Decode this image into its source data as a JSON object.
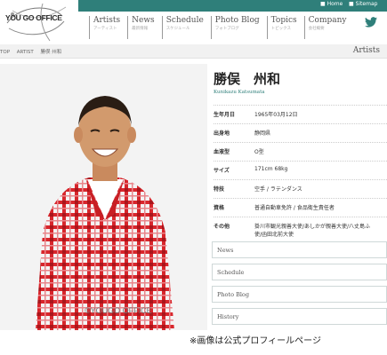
{
  "header": {
    "logo_text": "YOU GO OFFICE",
    "util_links": [
      {
        "icon": "home-icon",
        "label": "Home"
      },
      {
        "icon": "sitemap-icon",
        "label": "Sitemap"
      }
    ],
    "nav": [
      {
        "en": "Artists",
        "jp": "アーティスト"
      },
      {
        "en": "News",
        "jp": "最新情報"
      },
      {
        "en": "Schedule",
        "jp": "スケジュール"
      },
      {
        "en": "Photo Blog",
        "jp": "フォトブログ"
      },
      {
        "en": "Topics",
        "jp": "トピックス"
      },
      {
        "en": "Company",
        "jp": "会社概要"
      }
    ],
    "social_icon": "twitter-icon",
    "accent_color": "#2f7f7a"
  },
  "breadcrumb": [
    "TOP",
    "ARTIST",
    "勝俣 州和"
  ],
  "section_title": "Artists",
  "profile": {
    "name": "勝俣　州和",
    "name_romaji": "Kunikazu Katsumata",
    "rows": [
      {
        "key": "生年月日",
        "value": "1965年03月12日"
      },
      {
        "key": "出身地",
        "value": "静岡県"
      },
      {
        "key": "血液型",
        "value": "O型"
      },
      {
        "key": "サイズ",
        "value": "171cm 68kg"
      },
      {
        "key": "特技",
        "value": "空手 / ラテンダンス"
      },
      {
        "key": "資格",
        "value": "普通自動車免許 / 食品衛生責任者"
      },
      {
        "key": "その他",
        "value": "掛川市観光親善大使/あしかが親善大使/八丈島ふ",
        "value2": "使/函田北前大使"
      }
    ]
  },
  "link_boxes": [
    "News",
    "Schedule",
    "Photo Blog",
    "History"
  ],
  "photo_watermark": "©YOUGO OFFICE",
  "caption": "※画像は公式プロフィールページ"
}
